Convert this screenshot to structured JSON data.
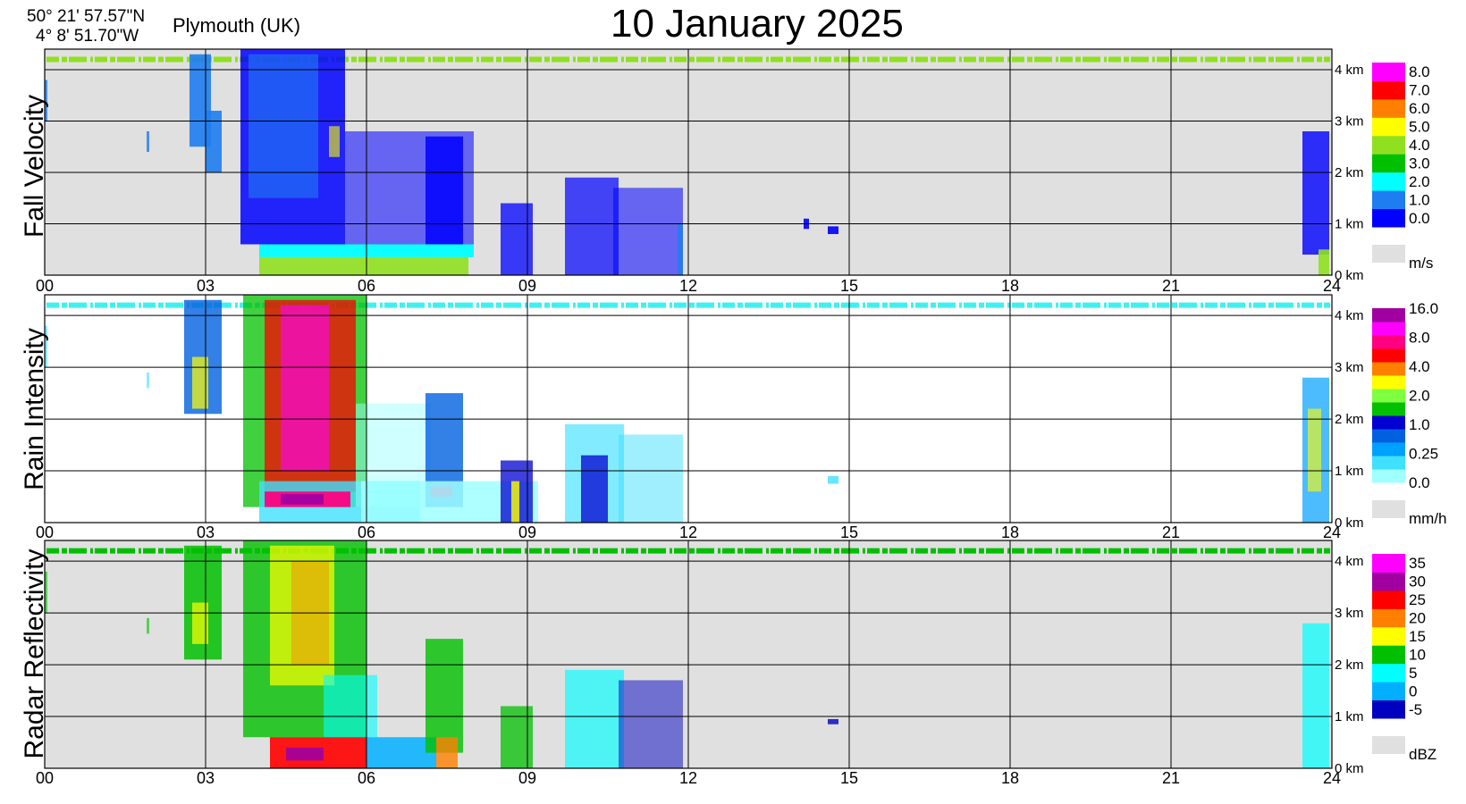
{
  "header": {
    "latitude": "50° 21' 57.57\"N",
    "longitude": "4°  8' 51.70\"W",
    "station": "Plymouth (UK)",
    "title": "10 January  2025"
  },
  "colors": {
    "no_data": "#e0e0e0",
    "grid": "#000000",
    "white": "#ffffff"
  },
  "chart_data": [
    {
      "type": "heatmap",
      "ylabel": "Fall Velocity",
      "unit": "m/s",
      "x_ticks": [
        "00",
        "03",
        "06",
        "09",
        "12",
        "15",
        "18",
        "21",
        "24"
      ],
      "xlim": [
        0,
        24
      ],
      "y_ticks": [
        "0 km",
        "1 km",
        "2 km",
        "3 km",
        "4 km"
      ],
      "ylim_km": [
        0,
        4.4
      ],
      "background": "#e0e0e0",
      "reference_band": {
        "height_km": 4.2,
        "color": "#90e020"
      },
      "legend": {
        "labels": [
          "0.0",
          "1.0",
          "2.0",
          "3.0",
          "4.0",
          "5.0",
          "6.0",
          "7.0",
          "8.0"
        ],
        "colors": [
          "#0000ff",
          "#1e7df0",
          "#00ffff",
          "#00c000",
          "#90e020",
          "#ffff00",
          "#ff8000",
          "#ff0000",
          "#ff00ff"
        ]
      },
      "features": [
        {
          "t0": 0.0,
          "t1": 0.05,
          "h0": 3.0,
          "h1": 3.8,
          "c": 1,
          "a": 0.8
        },
        {
          "t0": 2.7,
          "t1": 3.1,
          "h0": 2.5,
          "h1": 4.3,
          "c": 1,
          "a": 0.9
        },
        {
          "t0": 3.0,
          "t1": 3.3,
          "h0": 2.0,
          "h1": 3.2,
          "c": 1,
          "a": 0.9
        },
        {
          "t0": 1.9,
          "t1": 1.95,
          "h0": 2.4,
          "h1": 2.8,
          "c": 1,
          "a": 0.8
        },
        {
          "t0": 3.65,
          "t1": 5.6,
          "h0": 0.6,
          "h1": 4.4,
          "c": 0,
          "a": 0.85
        },
        {
          "t0": 3.8,
          "t1": 5.1,
          "h0": 1.5,
          "h1": 4.3,
          "c": 1,
          "a": 0.6
        },
        {
          "t0": 5.3,
          "t1": 5.5,
          "h0": 2.3,
          "h1": 2.9,
          "c": 5,
          "a": 0.6
        },
        {
          "t0": 4.0,
          "t1": 8.0,
          "h0": 0.35,
          "h1": 0.6,
          "c": 2,
          "a": 0.95
        },
        {
          "t0": 4.0,
          "t1": 7.9,
          "h0": 0.0,
          "h1": 0.35,
          "c": 4,
          "a": 0.9
        },
        {
          "t0": 5.6,
          "t1": 8.0,
          "h0": 0.6,
          "h1": 2.8,
          "c": 0,
          "a": 0.55
        },
        {
          "t0": 7.1,
          "t1": 7.8,
          "h0": 0.6,
          "h1": 2.7,
          "c": 0,
          "a": 0.85
        },
        {
          "t0": 8.5,
          "t1": 9.1,
          "h0": 0.0,
          "h1": 1.4,
          "c": 0,
          "a": 0.75
        },
        {
          "t0": 9.7,
          "t1": 10.7,
          "h0": 0.0,
          "h1": 1.9,
          "c": 0,
          "a": 0.7
        },
        {
          "t0": 10.6,
          "t1": 11.9,
          "h0": 0.0,
          "h1": 1.7,
          "c": 0,
          "a": 0.55
        },
        {
          "t0": 11.8,
          "t1": 11.9,
          "h0": 0.0,
          "h1": 1.0,
          "c": 1,
          "a": 0.8
        },
        {
          "t0": 14.15,
          "t1": 14.25,
          "h0": 0.9,
          "h1": 1.1,
          "c": 0,
          "a": 0.9
        },
        {
          "t0": 14.6,
          "t1": 14.8,
          "h0": 0.8,
          "h1": 0.95,
          "c": 0,
          "a": 0.9
        },
        {
          "t0": 23.45,
          "t1": 23.95,
          "h0": 0.4,
          "h1": 2.8,
          "c": 0,
          "a": 0.8
        },
        {
          "t0": 23.75,
          "t1": 23.95,
          "h0": 0.0,
          "h1": 0.5,
          "c": 4,
          "a": 0.9
        }
      ]
    },
    {
      "type": "heatmap",
      "ylabel": "Rain Intensity",
      "unit": "mm/h",
      "x_ticks": [
        "00",
        "03",
        "06",
        "09",
        "12",
        "15",
        "18",
        "21",
        "24"
      ],
      "xlim": [
        0,
        24
      ],
      "y_ticks": [
        "0 km",
        "1 km",
        "2 km",
        "3 km",
        "4 km"
      ],
      "ylim_km": [
        0,
        4.4
      ],
      "background": "#ffffff",
      "reference_band": {
        "height_km": 4.2,
        "color": "#40f0f0"
      },
      "legend": {
        "labels": [
          "0.0",
          "0.25",
          "1.0",
          "2.0",
          "4.0",
          "8.0",
          "16.0"
        ],
        "colors": [
          "#a0ffff",
          "#40e0ff",
          "#00a0ff",
          "#0060e0",
          "#0000d0",
          "#00c000",
          "#80ff40",
          "#ffff00",
          "#ff8000",
          "#ff0000",
          "#ff0080",
          "#ff00ff",
          "#a000a0"
        ]
      },
      "features": [
        {
          "t0": 0.0,
          "t1": 0.05,
          "h0": 3.0,
          "h1": 3.8,
          "c": 1,
          "a": 0.6
        },
        {
          "t0": 2.6,
          "t1": 3.3,
          "h0": 2.1,
          "h1": 4.3,
          "c": 3,
          "a": 0.8
        },
        {
          "t0": 2.75,
          "t1": 3.05,
          "h0": 2.2,
          "h1": 3.2,
          "c": 7,
          "a": 0.7
        },
        {
          "t0": 1.9,
          "t1": 1.95,
          "h0": 2.6,
          "h1": 2.9,
          "c": 1,
          "a": 0.6
        },
        {
          "t0": 3.7,
          "t1": 6.0,
          "h0": 0.3,
          "h1": 4.4,
          "c": 5,
          "a": 0.75
        },
        {
          "t0": 4.1,
          "t1": 5.8,
          "h0": 0.6,
          "h1": 4.3,
          "c": 9,
          "a": 0.75
        },
        {
          "t0": 4.4,
          "t1": 5.3,
          "h0": 1.0,
          "h1": 4.2,
          "c": 11,
          "a": 0.6
        },
        {
          "t0": 4.0,
          "t1": 7.0,
          "h0": 0.0,
          "h1": 0.8,
          "c": 1,
          "a": 0.8
        },
        {
          "t0": 4.1,
          "t1": 5.7,
          "h0": 0.3,
          "h1": 0.6,
          "c": 10,
          "a": 0.95
        },
        {
          "t0": 4.4,
          "t1": 5.2,
          "h0": 0.35,
          "h1": 0.55,
          "c": 12,
          "a": 0.95
        },
        {
          "t0": 5.8,
          "t1": 7.2,
          "h0": 0.3,
          "h1": 2.3,
          "c": 0,
          "a": 0.5
        },
        {
          "t0": 7.1,
          "t1": 7.8,
          "h0": 0.3,
          "h1": 2.5,
          "c": 3,
          "a": 0.8
        },
        {
          "t0": 7.2,
          "t1": 7.6,
          "h0": 0.5,
          "h1": 0.7,
          "c": 10,
          "a": 0.95
        },
        {
          "t0": 5.9,
          "t1": 9.2,
          "h0": 0.0,
          "h1": 0.8,
          "c": 0,
          "a": 0.85
        },
        {
          "t0": 8.5,
          "t1": 9.1,
          "h0": 0.0,
          "h1": 1.2,
          "c": 4,
          "a": 0.75
        },
        {
          "t0": 8.7,
          "t1": 8.85,
          "h0": 0.0,
          "h1": 0.8,
          "c": 7,
          "a": 0.8
        },
        {
          "t0": 9.7,
          "t1": 10.8,
          "h0": 0.0,
          "h1": 1.9,
          "c": 1,
          "a": 0.65
        },
        {
          "t0": 10.0,
          "t1": 10.5,
          "h0": 0.0,
          "h1": 1.3,
          "c": 4,
          "a": 0.75
        },
        {
          "t0": 10.7,
          "t1": 11.9,
          "h0": 0.0,
          "h1": 1.7,
          "c": 1,
          "a": 0.5
        },
        {
          "t0": 14.6,
          "t1": 14.8,
          "h0": 0.75,
          "h1": 0.9,
          "c": 1,
          "a": 0.8
        },
        {
          "t0": 23.45,
          "t1": 23.95,
          "h0": 0.0,
          "h1": 2.8,
          "c": 2,
          "a": 0.7
        },
        {
          "t0": 23.55,
          "t1": 23.8,
          "h0": 0.6,
          "h1": 2.2,
          "c": 7,
          "a": 0.6
        }
      ]
    },
    {
      "type": "heatmap",
      "ylabel": "Radar Reflectivity",
      "unit": "dBZ",
      "x_ticks": [
        "00",
        "03",
        "06",
        "09",
        "12",
        "15",
        "18",
        "21",
        "24"
      ],
      "xlim": [
        0,
        24
      ],
      "y_ticks": [
        "0 km",
        "1 km",
        "2 km",
        "3 km",
        "4 km"
      ],
      "ylim_km": [
        0,
        4.4
      ],
      "background": "#e0e0e0",
      "reference_band": {
        "height_km": 4.2,
        "color": "#00c000"
      },
      "legend": {
        "labels": [
          "-5",
          "0",
          "5",
          "10",
          "15",
          "20",
          "25",
          "30",
          "35"
        ],
        "colors": [
          "#0000c0",
          "#00b0ff",
          "#00ffff",
          "#00c000",
          "#ffff00",
          "#ff8000",
          "#ff0000",
          "#a000a0",
          "#ff00ff"
        ]
      },
      "features": [
        {
          "t0": 0.0,
          "t1": 0.05,
          "h0": 3.0,
          "h1": 3.8,
          "c": 3,
          "a": 0.6
        },
        {
          "t0": 2.6,
          "t1": 3.3,
          "h0": 2.1,
          "h1": 4.3,
          "c": 3,
          "a": 0.85
        },
        {
          "t0": 2.75,
          "t1": 3.05,
          "h0": 2.4,
          "h1": 3.2,
          "c": 4,
          "a": 0.7
        },
        {
          "t0": 1.9,
          "t1": 1.95,
          "h0": 2.6,
          "h1": 2.9,
          "c": 3,
          "a": 0.6
        },
        {
          "t0": 3.7,
          "t1": 6.0,
          "h0": 0.6,
          "h1": 4.4,
          "c": 3,
          "a": 0.8
        },
        {
          "t0": 4.2,
          "t1": 5.4,
          "h0": 1.6,
          "h1": 4.3,
          "c": 4,
          "a": 0.7
        },
        {
          "t0": 4.6,
          "t1": 5.3,
          "h0": 2.0,
          "h1": 4.0,
          "c": 5,
          "a": 0.45
        },
        {
          "t0": 5.2,
          "t1": 6.2,
          "h0": 0.6,
          "h1": 1.8,
          "c": 2,
          "a": 0.6
        },
        {
          "t0": 4.2,
          "t1": 6.0,
          "h0": 0.0,
          "h1": 0.6,
          "c": 6,
          "a": 0.9
        },
        {
          "t0": 4.5,
          "t1": 5.2,
          "h0": 0.15,
          "h1": 0.4,
          "c": 7,
          "a": 0.9
        },
        {
          "t0": 6.0,
          "t1": 7.3,
          "h0": 0.0,
          "h1": 0.6,
          "c": 1,
          "a": 0.85
        },
        {
          "t0": 7.1,
          "t1": 7.8,
          "h0": 0.3,
          "h1": 2.5,
          "c": 3,
          "a": 0.8
        },
        {
          "t0": 7.3,
          "t1": 7.7,
          "h0": 0.0,
          "h1": 0.6,
          "c": 5,
          "a": 0.8
        },
        {
          "t0": 8.5,
          "t1": 9.1,
          "h0": 0.0,
          "h1": 1.2,
          "c": 3,
          "a": 0.75
        },
        {
          "t0": 9.7,
          "t1": 10.8,
          "h0": 0.0,
          "h1": 1.9,
          "c": 2,
          "a": 0.65
        },
        {
          "t0": 10.7,
          "t1": 11.9,
          "h0": 0.0,
          "h1": 1.7,
          "c": 0,
          "a": 0.5
        },
        {
          "t0": 14.6,
          "t1": 14.8,
          "h0": 0.85,
          "h1": 0.95,
          "c": 0,
          "a": 0.8
        },
        {
          "t0": 23.45,
          "t1": 23.95,
          "h0": 0.0,
          "h1": 2.8,
          "c": 2,
          "a": 0.7
        }
      ]
    }
  ]
}
